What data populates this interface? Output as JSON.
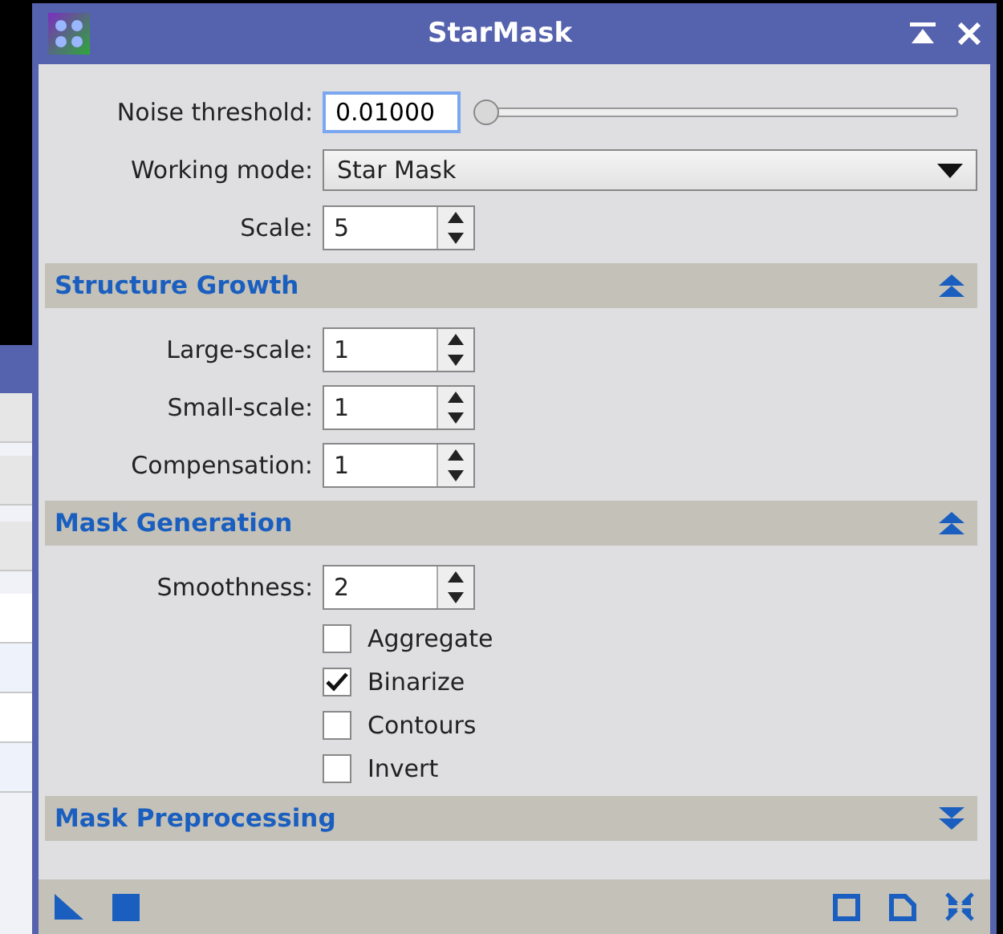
{
  "window": {
    "title": "StarMask"
  },
  "params": [
    {
      "kind": "slider",
      "label": "Noise threshold:",
      "value": "0.01000",
      "level": 0.0
    },
    {
      "kind": "dropdown",
      "label": "Working mode:",
      "value": "Star Mask"
    },
    {
      "kind": "spin",
      "label": "Scale:",
      "value": "5"
    }
  ],
  "sections": [
    {
      "title": "Structure Growth",
      "expanded": true,
      "params": [
        {
          "kind": "spin",
          "label": "Large-scale:",
          "value": "1"
        },
        {
          "kind": "spin",
          "label": "Small-scale:",
          "value": "1"
        },
        {
          "kind": "spin",
          "label": "Compensation:",
          "value": "1"
        }
      ]
    },
    {
      "title": "Mask Generation",
      "expanded": true,
      "params": [
        {
          "kind": "spin",
          "label": "Smoothness:",
          "value": "2"
        },
        {
          "kind": "check",
          "label": "Aggregate",
          "checked": false
        },
        {
          "kind": "check",
          "label": "Binarize",
          "checked": true
        },
        {
          "kind": "check",
          "label": "Contours",
          "checked": false
        },
        {
          "kind": "check",
          "label": "Invert",
          "checked": false
        }
      ]
    },
    {
      "title": "Mask Preprocessing",
      "expanded": false
    }
  ]
}
